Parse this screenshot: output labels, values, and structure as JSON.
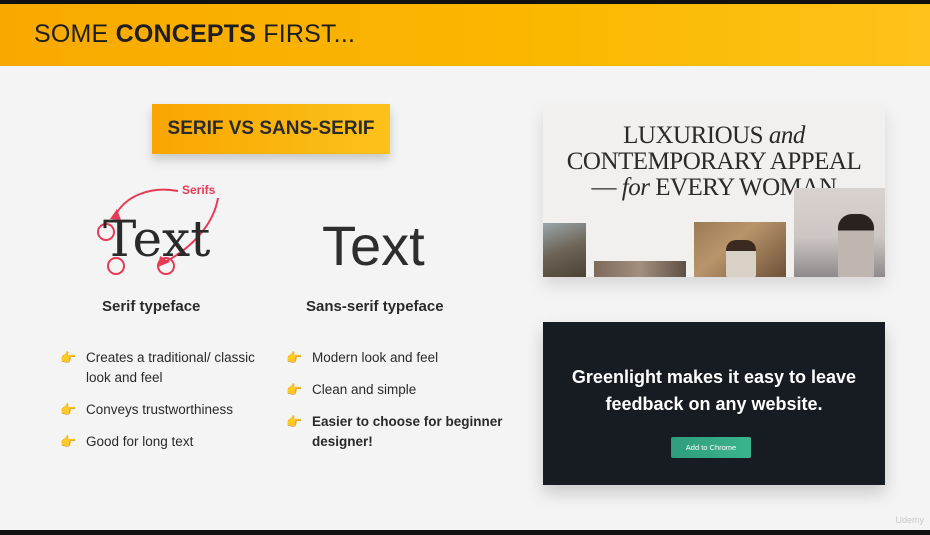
{
  "header": {
    "title_prefix": "SOME ",
    "title_bold": "CONCEPTS",
    "title_suffix": " FIRST..."
  },
  "badge": {
    "label": "SERIF VS SANS-SERIF"
  },
  "serif_demo": {
    "sample_text": "Text",
    "annotation_label": "Serifs",
    "title": "Serif typeface",
    "bullets": [
      "Creates a traditional/ classic look and feel",
      "Conveys trustworthiness",
      "Good for long text"
    ]
  },
  "sans_demo": {
    "sample_text": "Text",
    "title": "Sans-serif typeface",
    "bullets": [
      "Modern look and feel",
      "Clean and simple",
      "Easier to choose for beginner designer!"
    ]
  },
  "fashion_card": {
    "line1": "LUXURIOUS",
    "line1_italic": "and",
    "line2": "CONTEMPORARY APPEAL",
    "line3_prefix": "—",
    "line3_italic": "for",
    "line3_suffix": "EVERY WOMAN"
  },
  "green_card": {
    "headline_line1": "Greenlight makes it easy to leave",
    "headline_line2": "feedback on any website.",
    "button_label": "Add to Chrome"
  },
  "watermark": "Udemy",
  "colors": {
    "accent": "#f8a900",
    "annotation": "#e63a55",
    "dark_card": "#171b22",
    "button_green": "#3bb48e"
  },
  "icons": {
    "bullet": "pointing-hand-icon"
  }
}
